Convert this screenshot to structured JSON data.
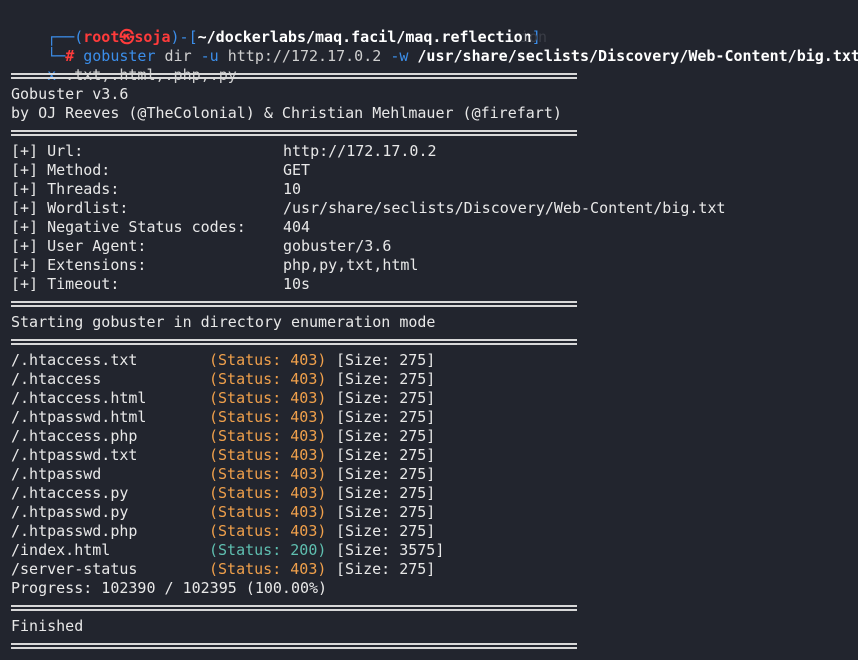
{
  "prompt": {
    "user": "root",
    "host": "soja",
    "cwd": "~/dockerlabs/maq.facil/maq.reflection",
    "ghost_text": "ion",
    "symbol": "#",
    "command_name": "gobuster",
    "command_rest1": " dir ",
    "flag_u": "-u",
    "url_arg": " http://172.17.0.2 ",
    "flag_w": "-w",
    "wordlist_arg": " /usr/share/seclists/Discovery/Web-Content/big.txt ",
    "trail_dash": "-",
    "flag_x": "x",
    "ext_arg": " .txt,.html,.php,.py"
  },
  "banner": {
    "version": "Gobuster v3.6",
    "authors": "by OJ Reeves (@TheColonial) & Christian Mehlmauer (@firefart)"
  },
  "config": [
    {
      "key": "[+] Url:",
      "value": "http://172.17.0.2"
    },
    {
      "key": "[+] Method:",
      "value": "GET"
    },
    {
      "key": "[+] Threads:",
      "value": "10"
    },
    {
      "key": "[+] Wordlist:",
      "value": "/usr/share/seclists/Discovery/Web-Content/big.txt"
    },
    {
      "key": "[+] Negative Status codes:",
      "value": "404"
    },
    {
      "key": "[+] User Agent:",
      "value": "gobuster/3.6"
    },
    {
      "key": "[+] Extensions:",
      "value": "php,py,txt,html"
    },
    {
      "key": "[+] Timeout:",
      "value": "10s"
    }
  ],
  "mode_line": "Starting gobuster in directory enumeration mode",
  "results": [
    {
      "path": "/.htaccess.txt",
      "status": "(Status: 403)",
      "size": "[Size: 275]",
      "color": "#f0a04b"
    },
    {
      "path": "/.htaccess",
      "status": "(Status: 403)",
      "size": "[Size: 275]",
      "color": "#f0a04b"
    },
    {
      "path": "/.htaccess.html",
      "status": "(Status: 403)",
      "size": "[Size: 275]",
      "color": "#f0a04b"
    },
    {
      "path": "/.htpasswd.html",
      "status": "(Status: 403)",
      "size": "[Size: 275]",
      "color": "#f0a04b"
    },
    {
      "path": "/.htaccess.php",
      "status": "(Status: 403)",
      "size": "[Size: 275]",
      "color": "#f0a04b"
    },
    {
      "path": "/.htpasswd.txt",
      "status": "(Status: 403)",
      "size": "[Size: 275]",
      "color": "#f0a04b"
    },
    {
      "path": "/.htpasswd",
      "status": "(Status: 403)",
      "size": "[Size: 275]",
      "color": "#f0a04b"
    },
    {
      "path": "/.htaccess.py",
      "status": "(Status: 403)",
      "size": "[Size: 275]",
      "color": "#f0a04b"
    },
    {
      "path": "/.htpasswd.py",
      "status": "(Status: 403)",
      "size": "[Size: 275]",
      "color": "#f0a04b"
    },
    {
      "path": "/.htpasswd.php",
      "status": "(Status: 403)",
      "size": "[Size: 275]",
      "color": "#f0a04b"
    },
    {
      "path": "/index.html",
      "status": "(Status: 200)",
      "size": "[Size: 3575]",
      "color": "#5fbfb0"
    },
    {
      "path": "/server-status",
      "status": "(Status: 403)",
      "size": "[Size: 275]",
      "color": "#f0a04b"
    }
  ],
  "progress": "Progress: 102390 / 102395 (100.00%)",
  "finished": "Finished"
}
